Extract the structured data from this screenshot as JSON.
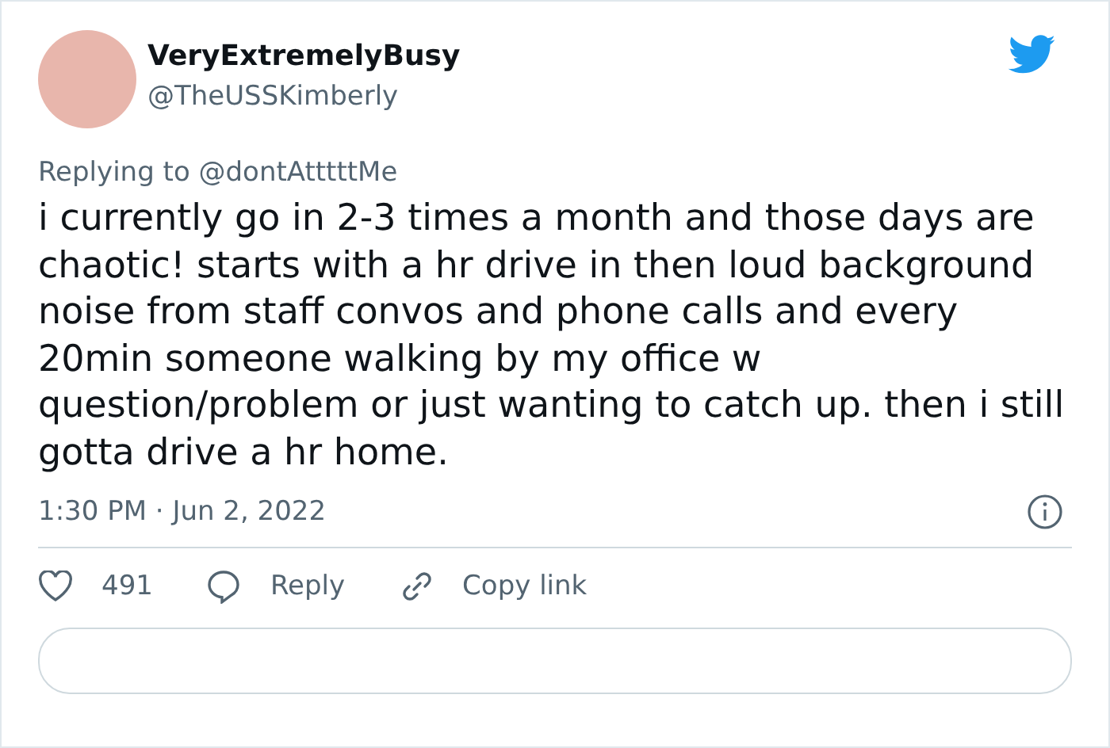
{
  "author": {
    "name": "VeryExtremelyBusy",
    "handle": "@TheUSSKimberly"
  },
  "reply_to": {
    "prefix": "Replying to",
    "handle": "@dontAtttttMe"
  },
  "body": "i currently go in 2-3 times a month and those days are chaotic! starts with a hr drive in then loud background noise from staff convos and phone calls and every 20min someone walking by my office w question/problem or just wanting to catch up. then i still gotta drive a hr home.",
  "timestamp": "1:30 PM · Jun 2, 2022",
  "actions": [
    {
      "kind": "like",
      "label": "491"
    },
    {
      "kind": "reply",
      "label": "Reply"
    },
    {
      "kind": "link",
      "label": "Copy link"
    }
  ]
}
